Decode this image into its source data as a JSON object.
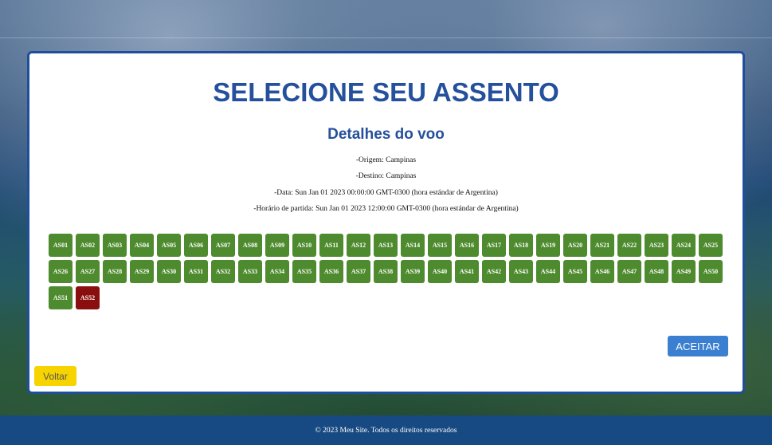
{
  "page": {
    "title": "SELECIONE SEU ASSENTO",
    "subtitle": "Detalhes do voo"
  },
  "flight_details": {
    "origin": "-Origem: Campinas",
    "destination": "-Destino: Campinas",
    "date": "-Data: Sun Jan 01 2023 00:00:00 GMT-0300 (hora estándar de Argentina)",
    "departure_time": "-Horário de partida: Sun Jan 01 2023 12:00:00 GMT-0300 (hora estándar de Argentina)"
  },
  "seats": [
    {
      "label": "AS01",
      "status": "available"
    },
    {
      "label": "AS02",
      "status": "available"
    },
    {
      "label": "AS03",
      "status": "available"
    },
    {
      "label": "AS04",
      "status": "available"
    },
    {
      "label": "AS05",
      "status": "available"
    },
    {
      "label": "AS06",
      "status": "available"
    },
    {
      "label": "AS07",
      "status": "available"
    },
    {
      "label": "AS08",
      "status": "available"
    },
    {
      "label": "AS09",
      "status": "available"
    },
    {
      "label": "AS10",
      "status": "available"
    },
    {
      "label": "AS11",
      "status": "available"
    },
    {
      "label": "AS12",
      "status": "available"
    },
    {
      "label": "AS13",
      "status": "available"
    },
    {
      "label": "AS14",
      "status": "available"
    },
    {
      "label": "AS15",
      "status": "available"
    },
    {
      "label": "AS16",
      "status": "available"
    },
    {
      "label": "AS17",
      "status": "available"
    },
    {
      "label": "AS18",
      "status": "available"
    },
    {
      "label": "AS19",
      "status": "available"
    },
    {
      "label": "AS20",
      "status": "available"
    },
    {
      "label": "AS21",
      "status": "available"
    },
    {
      "label": "AS22",
      "status": "available"
    },
    {
      "label": "AS23",
      "status": "available"
    },
    {
      "label": "AS24",
      "status": "available"
    },
    {
      "label": "AS25",
      "status": "available"
    },
    {
      "label": "AS26",
      "status": "available"
    },
    {
      "label": "AS27",
      "status": "available"
    },
    {
      "label": "AS28",
      "status": "available"
    },
    {
      "label": "AS29",
      "status": "available"
    },
    {
      "label": "AS30",
      "status": "available"
    },
    {
      "label": "AS31",
      "status": "available"
    },
    {
      "label": "AS32",
      "status": "available"
    },
    {
      "label": "AS33",
      "status": "available"
    },
    {
      "label": "AS34",
      "status": "available"
    },
    {
      "label": "AS35",
      "status": "available"
    },
    {
      "label": "AS36",
      "status": "available"
    },
    {
      "label": "AS37",
      "status": "available"
    },
    {
      "label": "AS38",
      "status": "available"
    },
    {
      "label": "AS39",
      "status": "available"
    },
    {
      "label": "AS40",
      "status": "available"
    },
    {
      "label": "AS41",
      "status": "available"
    },
    {
      "label": "AS42",
      "status": "available"
    },
    {
      "label": "AS43",
      "status": "available"
    },
    {
      "label": "AS44",
      "status": "available"
    },
    {
      "label": "AS45",
      "status": "available"
    },
    {
      "label": "AS46",
      "status": "available"
    },
    {
      "label": "AS47",
      "status": "available"
    },
    {
      "label": "AS48",
      "status": "available"
    },
    {
      "label": "AS49",
      "status": "available"
    },
    {
      "label": "AS50",
      "status": "available"
    },
    {
      "label": "AS51",
      "status": "available"
    },
    {
      "label": "AS52",
      "status": "selected"
    }
  ],
  "colors": {
    "title": "#24509c",
    "seat_available": "#4e8a2e",
    "seat_selected": "#8b0e0e",
    "accept_button": "#3a7fd0",
    "back_button": "#f7d300",
    "footer": "#174a82"
  },
  "actions": {
    "accept_label": "ACEITAR",
    "back_label": "Voltar"
  },
  "footer": {
    "text": "© 2023 Meu Site. Todos os direitos reservados"
  }
}
